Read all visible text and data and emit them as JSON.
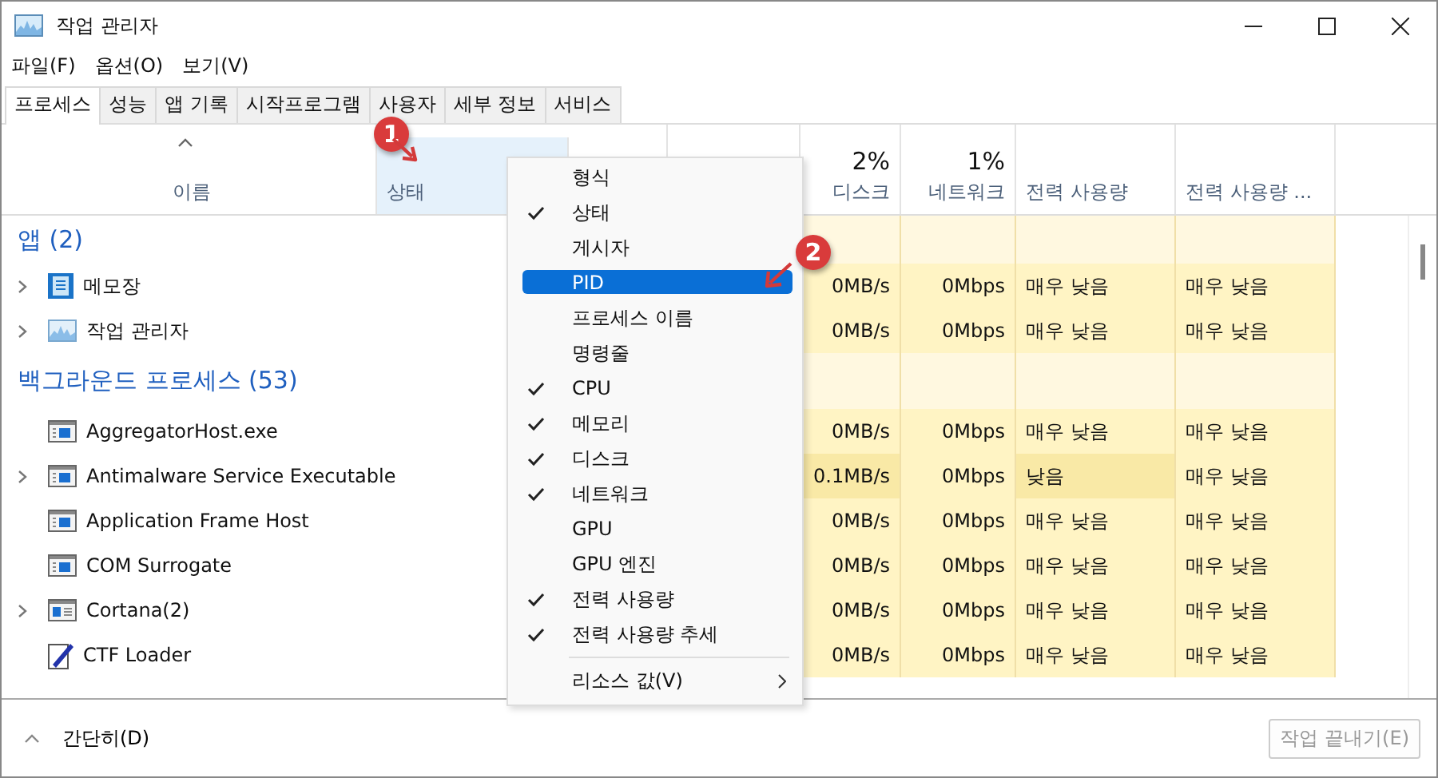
{
  "window": {
    "title": "작업 관리자"
  },
  "menu_bar": [
    "파일(F)",
    "옵션(O)",
    "보기(V)"
  ],
  "tabs": [
    {
      "label": "프로세스",
      "selected": true
    },
    {
      "label": "성능",
      "selected": false
    },
    {
      "label": "앱 기록",
      "selected": false
    },
    {
      "label": "시작프로그램",
      "selected": false
    },
    {
      "label": "사용자",
      "selected": false
    },
    {
      "label": "세부 정보",
      "selected": false
    },
    {
      "label": "서비스",
      "selected": false
    }
  ],
  "columns": [
    {
      "label": "이름",
      "kind": "name",
      "sorted": true,
      "hovered": false
    },
    {
      "label": "상태",
      "kind": "text",
      "hovered": true
    },
    {
      "kind": "hidden",
      "hovered": false
    },
    {
      "kind": "hidden",
      "hovered": false
    },
    {
      "label": "디스크",
      "value": "2%",
      "kind": "num",
      "hovered": false
    },
    {
      "label": "네트워크",
      "value": "1%",
      "kind": "num",
      "hovered": false
    },
    {
      "label": "전력 사용량",
      "kind": "text",
      "hovered": false
    },
    {
      "label": "전력 사용량 ...",
      "kind": "text",
      "hovered": false
    }
  ],
  "groups": [
    {
      "title": "앱 (2)",
      "rows": [
        {
          "name": "메모장",
          "expandable": true,
          "kind": "notepad",
          "cells": [
            {
              "text": "0MB/s",
              "high": false
            },
            {
              "text": "0Mbps",
              "high": false
            },
            {
              "text": "매우 낮음",
              "high": false
            },
            {
              "text": "매우 낮음",
              "high": false
            }
          ]
        },
        {
          "name": "작업 관리자",
          "expandable": true,
          "kind": "taskmgr",
          "cells": [
            {
              "text": "0MB/s",
              "high": false
            },
            {
              "text": "0Mbps",
              "high": false
            },
            {
              "text": "매우 낮음",
              "high": false
            },
            {
              "text": "매우 낮음",
              "high": false
            }
          ]
        }
      ]
    },
    {
      "title": "백그라운드 프로세스 (53)",
      "rows": [
        {
          "name": "AggregatorHost.exe",
          "expandable": false,
          "kind": "exe",
          "cells": [
            {
              "text": "0MB/s",
              "high": false
            },
            {
              "text": "0Mbps",
              "high": false
            },
            {
              "text": "매우 낮음",
              "high": false
            },
            {
              "text": "매우 낮음",
              "high": false
            }
          ]
        },
        {
          "name": "Antimalware Service Executable",
          "expandable": true,
          "kind": "exe",
          "cells": [
            {
              "text": "0.1MB/s",
              "high": true
            },
            {
              "text": "0Mbps",
              "high": false
            },
            {
              "text": "낮음",
              "high": true
            },
            {
              "text": "매우 낮음",
              "high": false
            }
          ]
        },
        {
          "name": "Application Frame Host",
          "expandable": false,
          "kind": "exe",
          "cells": [
            {
              "text": "0MB/s",
              "high": false
            },
            {
              "text": "0Mbps",
              "high": false
            },
            {
              "text": "매우 낮음",
              "high": false
            },
            {
              "text": "매우 낮음",
              "high": false
            }
          ]
        },
        {
          "name": "COM Surrogate",
          "expandable": false,
          "kind": "exe",
          "cells": [
            {
              "text": "0MB/s",
              "high": false
            },
            {
              "text": "0Mbps",
              "high": false
            },
            {
              "text": "매우 낮음",
              "high": false
            },
            {
              "text": "매우 낮음",
              "high": false
            }
          ]
        },
        {
          "name": "Cortana(2)",
          "expandable": true,
          "kind": "window",
          "cells": [
            {
              "text": "0MB/s",
              "high": false
            },
            {
              "text": "0Mbps",
              "high": false
            },
            {
              "text": "매우 낮음",
              "high": false
            },
            {
              "text": "매우 낮음",
              "high": false
            }
          ]
        },
        {
          "name": "CTF Loader",
          "expandable": false,
          "kind": "pen",
          "cells": [
            {
              "text": "0MB/s",
              "high": false
            },
            {
              "text": "0Mbps",
              "high": false
            },
            {
              "text": "매우 낮음",
              "high": false
            },
            {
              "text": "매우 낮음",
              "high": false
            }
          ]
        }
      ]
    }
  ],
  "context_menu": [
    {
      "label": "형식",
      "kind": "item",
      "checked": false,
      "selected": false
    },
    {
      "label": "상태",
      "kind": "item",
      "checked": true,
      "selected": false
    },
    {
      "label": "게시자",
      "kind": "item",
      "checked": false,
      "selected": false
    },
    {
      "label": "PID",
      "kind": "item",
      "checked": false,
      "selected": true
    },
    {
      "label": "프로세스 이름",
      "kind": "item",
      "checked": false,
      "selected": false
    },
    {
      "label": "명령줄",
      "kind": "item",
      "checked": false,
      "selected": false
    },
    {
      "label": "CPU",
      "kind": "item",
      "checked": true,
      "selected": false
    },
    {
      "label": "메모리",
      "kind": "item",
      "checked": true,
      "selected": false
    },
    {
      "label": "디스크",
      "kind": "item",
      "checked": true,
      "selected": false
    },
    {
      "label": "네트워크",
      "kind": "item",
      "checked": true,
      "selected": false
    },
    {
      "label": "GPU",
      "kind": "item",
      "checked": false,
      "selected": false
    },
    {
      "label": "GPU 엔진",
      "kind": "item",
      "checked": false,
      "selected": false
    },
    {
      "label": "전력 사용량",
      "kind": "item",
      "checked": true,
      "selected": false
    },
    {
      "label": "전력 사용량 추세",
      "kind": "item",
      "checked": true,
      "selected": false
    },
    {
      "label": "리소스 값(V)",
      "kind": "submenu",
      "checked": false,
      "selected": false
    }
  ],
  "annotations": [
    "1",
    "2"
  ],
  "footer": {
    "toggle": "간단히(D)",
    "end_task": {
      "label": "작업 끝내기(E)",
      "disabled": true
    }
  }
}
